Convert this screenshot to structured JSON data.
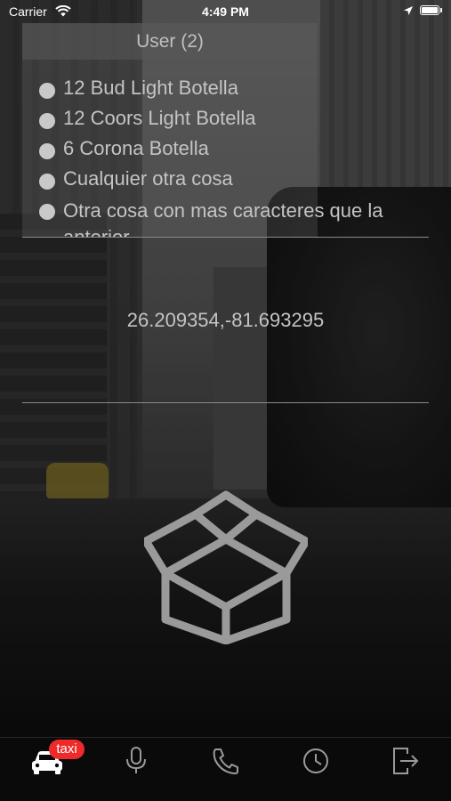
{
  "status_bar": {
    "carrier": "Carrier",
    "time": "4:49 PM"
  },
  "header": {
    "title": "User (2)"
  },
  "order_items": [
    "12 Bud Light Botella",
    "12 Coors Light Botella",
    "6 Corona Botella",
    "Cualquier otra cosa",
    "Otra cosa con mas caracteres que la anterior"
  ],
  "location": {
    "coordinates": "26.209354,-81.693295"
  },
  "tab_bar": {
    "taxi_badge": "taxi",
    "tabs": [
      "car-icon",
      "microphone-icon",
      "phone-icon",
      "clock-icon",
      "logout-icon"
    ]
  },
  "colors": {
    "badge": "#ee2a2a",
    "text": "#c4c4c4",
    "icon": "#9a9a9a"
  }
}
